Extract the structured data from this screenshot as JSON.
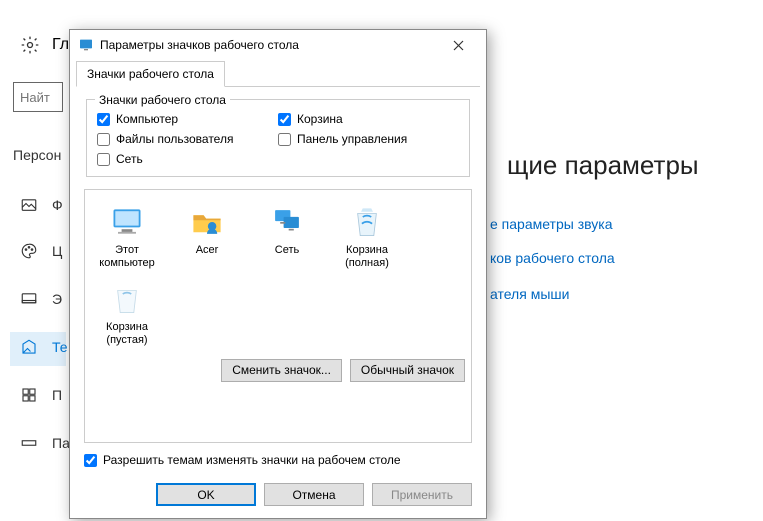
{
  "bg": {
    "home_label": "Гл",
    "search_placeholder": "Найт",
    "category": "Персон",
    "sidebar": [
      {
        "label": "Ф"
      },
      {
        "label": "Ц"
      },
      {
        "label": "Э"
      },
      {
        "label": "Те"
      },
      {
        "label": "П"
      },
      {
        "label": "Па"
      }
    ],
    "h1_fragment": "щие параметры",
    "links": [
      "е параметры звука",
      "ков рабочего стола",
      "ателя мыши"
    ]
  },
  "dlg": {
    "title": "Параметры значков рабочего стола",
    "tab": "Значки рабочего стола",
    "fieldset_legend": "Значки рабочего стола",
    "checks": {
      "computer": {
        "label": "Компьютер",
        "checked": true
      },
      "userfiles": {
        "label": "Файлы пользователя",
        "checked": false
      },
      "network": {
        "label": "Сеть",
        "checked": false
      },
      "recycle": {
        "label": "Корзина",
        "checked": true
      },
      "cpanel": {
        "label": "Панель управления",
        "checked": false
      }
    },
    "icons": [
      {
        "name": "Этот компьютер",
        "kind": "pc"
      },
      {
        "name": "Acer",
        "kind": "user"
      },
      {
        "name": "Сеть",
        "kind": "net"
      },
      {
        "name": "Корзина (полная)",
        "kind": "bin-full"
      },
      {
        "name": "Корзина (пустая)",
        "kind": "bin-empty"
      }
    ],
    "btn_change": "Сменить значок...",
    "btn_default": "Обычный значок",
    "allow_themes": {
      "label": "Разрешить темам изменять значки на рабочем столе",
      "checked": true
    },
    "btn_ok": "OK",
    "btn_cancel": "Отмена",
    "btn_apply": "Применить"
  }
}
